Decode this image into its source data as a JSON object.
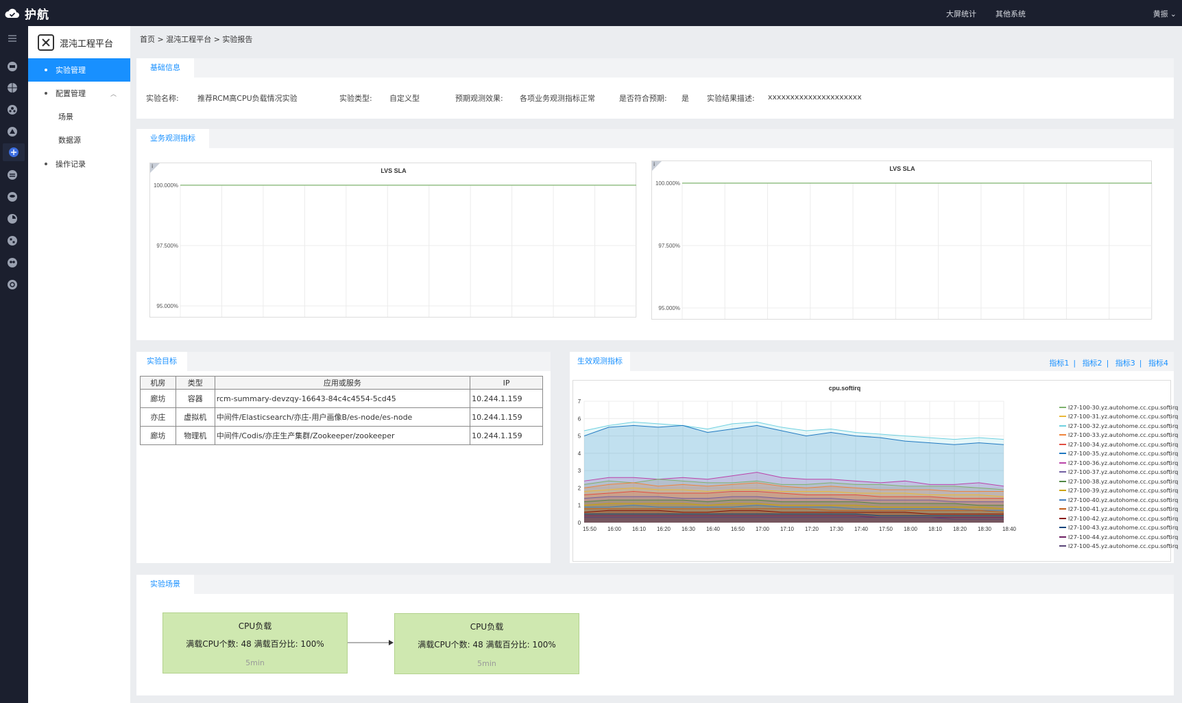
{
  "app": {
    "name": "护航"
  },
  "topnav": {
    "items": [
      "大屏统计",
      "其他系统"
    ],
    "user": "黄振"
  },
  "rail": {
    "icons": [
      "menu-icon",
      "chat-icon",
      "globe-icon",
      "cluster-icon",
      "triangle-icon",
      "network-icon",
      "layers-icon",
      "database-icon",
      "report-icon",
      "dashboard-icon",
      "users-icon",
      "settings-icon"
    ]
  },
  "sidebar": {
    "title": "混沌工程平台",
    "items": [
      {
        "label": "实验管理",
        "active": true
      },
      {
        "label": "配置管理",
        "expanded": true
      },
      {
        "label": "场景"
      },
      {
        "label": "数据源"
      },
      {
        "label": "操作记录"
      }
    ]
  },
  "breadcrumb": "首页 > 混沌工程平台 > 实验报告",
  "basic": {
    "tab": "基础信息",
    "fields": [
      {
        "label": "实验名称:",
        "value": "推荐RCM高CPU负载情况实验"
      },
      {
        "label": "实验类型:",
        "value": "自定义型"
      },
      {
        "label": "预期观测效果:",
        "value": "各项业务观测指标正常"
      },
      {
        "label": "是否符合预期:",
        "value": "是"
      },
      {
        "label": "实验结果描述:",
        "value": "xxxxxxxxxxxxxxxxxxxxx"
      }
    ]
  },
  "business": {
    "tab": "业务观测指标"
  },
  "target": {
    "tab": "实验目标",
    "columns": [
      "机房",
      "类型",
      "应用或服务",
      "IP"
    ],
    "rows": [
      [
        "廊坊",
        "容器",
        "rcm-summary-devzqy-16643-84c4c4554-5cd45",
        "10.244.1.159"
      ],
      [
        "亦庄",
        "虚拟机",
        "中间件/Elasticsearch/亦庄-用户画像B/es-node/es-node",
        "10.244.1.159"
      ],
      [
        "廊坊",
        "物理机",
        "中间件/Codis/亦庄生产集群/Zookeeper/zookeeper",
        "10.244.1.159"
      ]
    ]
  },
  "effect": {
    "tab": "生效观测指标",
    "links": [
      "指标1",
      "指标2",
      "指标3",
      "指标4"
    ]
  },
  "scenario": {
    "tab": "实验场景",
    "steps": [
      {
        "title": "CPU负载",
        "desc": "满载CPU个数: 48  满载百分比: 100%",
        "duration": "5min"
      },
      {
        "title": "CPU负载",
        "desc": "满载CPU个数: 48  满载百分比: 100%",
        "duration": "5min"
      }
    ]
  },
  "chart_data": [
    {
      "type": "line",
      "title": "LVS SLA",
      "ylim": [
        95,
        100
      ],
      "yticks": [
        "100.000%",
        "97.500%",
        "95.000%"
      ],
      "series": [
        {
          "values": [
            100,
            100,
            100,
            100,
            100,
            100,
            100,
            100,
            100,
            100,
            100,
            100
          ]
        }
      ],
      "grid": true,
      "color": "#7eb26d"
    },
    {
      "type": "line",
      "title": "LVS SLA",
      "ylim": [
        95,
        100
      ],
      "yticks": [
        "100.000%",
        "97.500%",
        "95.000%"
      ],
      "series": [
        {
          "values": [
            100,
            100,
            100,
            100,
            100,
            100,
            100,
            100,
            100,
            100,
            100,
            100
          ]
        }
      ],
      "grid": true,
      "color": "#7eb26d"
    },
    {
      "type": "area",
      "title": "cpu.softirq",
      "ylim": [
        0,
        7
      ],
      "yticks": [
        "0",
        "1",
        "2",
        "3",
        "4",
        "5",
        "6",
        "7"
      ],
      "x": [
        "15:50",
        "16:00",
        "16:10",
        "16:20",
        "16:30",
        "16:40",
        "16:50",
        "17:00",
        "17:10",
        "17:20",
        "17:30",
        "17:40",
        "17:50",
        "18:00",
        "18:10",
        "18:20",
        "18:30",
        "18:40"
      ],
      "legend_position": "right",
      "series": [
        {
          "name": "l27-100-30.yz.autohome.cc.cpu.softirq",
          "color": "#7eb26d",
          "values": [
            2.2,
            2.4,
            2.3,
            2.5,
            2.4,
            2.3,
            2.3,
            2.4,
            2.2,
            2.2,
            2.3,
            2.2,
            2.2,
            2.1,
            2.1,
            2.1,
            2.0,
            1.9
          ]
        },
        {
          "name": "l27-100-31.yz.autohome.cc.cpu.softirq",
          "color": "#eab839",
          "values": [
            1.8,
            1.9,
            2.0,
            1.9,
            1.9,
            1.8,
            1.9,
            1.9,
            1.8,
            1.8,
            1.8,
            1.7,
            1.7,
            1.7,
            1.6,
            1.6,
            1.6,
            1.5
          ]
        },
        {
          "name": "l27-100-32.yz.autohome.cc.cpu.softirq",
          "color": "#6ed0e0",
          "values": [
            5.3,
            5.6,
            5.8,
            5.7,
            5.6,
            5.4,
            5.7,
            5.8,
            5.5,
            5.3,
            5.4,
            5.2,
            5.1,
            5.0,
            4.9,
            4.8,
            4.9,
            4.8
          ]
        },
        {
          "name": "l27-100-33.yz.autohome.cc.cpu.softirq",
          "color": "#ef843c",
          "values": [
            2.0,
            2.2,
            2.3,
            2.1,
            2.2,
            2.1,
            2.2,
            2.3,
            2.1,
            2.0,
            2.1,
            2.0,
            1.9,
            1.9,
            1.9,
            1.8,
            1.8,
            1.8
          ]
        },
        {
          "name": "l27-100-34.yz.autohome.cc.cpu.softirq",
          "color": "#e24d42",
          "values": [
            1.6,
            1.7,
            1.8,
            1.7,
            1.7,
            1.7,
            1.8,
            1.8,
            1.7,
            1.6,
            1.6,
            1.6,
            1.5,
            1.5,
            1.5,
            1.4,
            1.4,
            1.4
          ]
        },
        {
          "name": "l27-100-35.yz.autohome.cc.cpu.softirq",
          "color": "#1f78c1",
          "values": [
            5.0,
            5.5,
            5.6,
            5.5,
            5.6,
            5.2,
            5.4,
            5.6,
            5.3,
            5.0,
            5.2,
            5.0,
            4.9,
            4.7,
            4.6,
            4.5,
            4.6,
            4.5
          ]
        },
        {
          "name": "l27-100-36.yz.autohome.cc.cpu.softirq",
          "color": "#ba43a9",
          "values": [
            2.4,
            2.6,
            2.6,
            2.5,
            2.6,
            2.5,
            2.7,
            2.9,
            2.6,
            2.5,
            2.5,
            2.4,
            2.3,
            2.4,
            2.2,
            2.2,
            2.3,
            2.1
          ]
        },
        {
          "name": "l27-100-37.yz.autohome.cc.cpu.softirq",
          "color": "#705da0",
          "values": [
            1.4,
            1.5,
            1.5,
            1.5,
            1.4,
            1.4,
            1.5,
            1.5,
            1.4,
            1.4,
            1.4,
            1.3,
            1.3,
            1.3,
            1.3,
            1.2,
            1.2,
            1.2
          ]
        },
        {
          "name": "l27-100-38.yz.autohome.cc.cpu.softirq",
          "color": "#508642",
          "values": [
            1.2,
            1.3,
            1.3,
            1.3,
            1.3,
            1.2,
            1.3,
            1.3,
            1.2,
            1.2,
            1.2,
            1.2,
            1.1,
            1.1,
            1.1,
            1.1,
            1.0,
            1.0
          ]
        },
        {
          "name": "l27-100-39.yz.autohome.cc.cpu.softirq",
          "color": "#cca300",
          "values": [
            1.0,
            1.1,
            1.1,
            1.1,
            1.1,
            1.0,
            1.1,
            1.1,
            1.0,
            1.0,
            1.0,
            1.0,
            0.9,
            0.9,
            0.9,
            0.9,
            0.9,
            0.8
          ]
        },
        {
          "name": "l27-100-40.yz.autohome.cc.cpu.softirq",
          "color": "#447ebc",
          "values": [
            0.9,
            0.9,
            1.0,
            0.9,
            0.9,
            0.9,
            0.9,
            1.0,
            0.9,
            0.9,
            0.9,
            0.8,
            0.8,
            0.8,
            0.8,
            0.8,
            0.7,
            0.7
          ]
        },
        {
          "name": "l27-100-41.yz.autohome.cc.cpu.softirq",
          "color": "#c15c17",
          "values": [
            0.8,
            0.8,
            0.8,
            0.8,
            0.8,
            0.8,
            0.8,
            0.8,
            0.8,
            0.8,
            0.7,
            0.7,
            0.7,
            0.7,
            0.7,
            0.7,
            0.7,
            0.6
          ]
        },
        {
          "name": "l27-100-42.yz.autohome.cc.cpu.softirq",
          "color": "#890f02",
          "values": [
            0.6,
            0.7,
            0.7,
            0.7,
            0.6,
            0.6,
            0.7,
            0.7,
            0.6,
            0.6,
            0.6,
            0.6,
            0.6,
            0.6,
            0.5,
            0.5,
            0.5,
            0.5
          ]
        },
        {
          "name": "l27-100-43.yz.autohome.cc.cpu.softirq",
          "color": "#0a437c",
          "values": [
            0.5,
            0.5,
            0.5,
            0.5,
            0.5,
            0.5,
            0.5,
            0.5,
            0.5,
            0.5,
            0.5,
            0.5,
            0.4,
            0.4,
            0.4,
            0.4,
            0.4,
            0.4
          ]
        },
        {
          "name": "l27-100-44.yz.autohome.cc.cpu.softirq",
          "color": "#6d1f62",
          "values": [
            0.4,
            0.4,
            0.4,
            0.4,
            0.4,
            0.4,
            0.4,
            0.4,
            0.4,
            0.4,
            0.4,
            0.4,
            0.3,
            0.3,
            0.3,
            0.3,
            0.3,
            0.3
          ]
        },
        {
          "name": "l27-100-45.yz.autohome.cc.cpu.softirq",
          "color": "#584477",
          "values": [
            0.3,
            0.3,
            0.3,
            0.3,
            0.3,
            0.3,
            0.3,
            0.3,
            0.3,
            0.3,
            0.3,
            0.3,
            0.3,
            0.3,
            0.3,
            0.2,
            0.2,
            0.2
          ]
        }
      ]
    }
  ]
}
